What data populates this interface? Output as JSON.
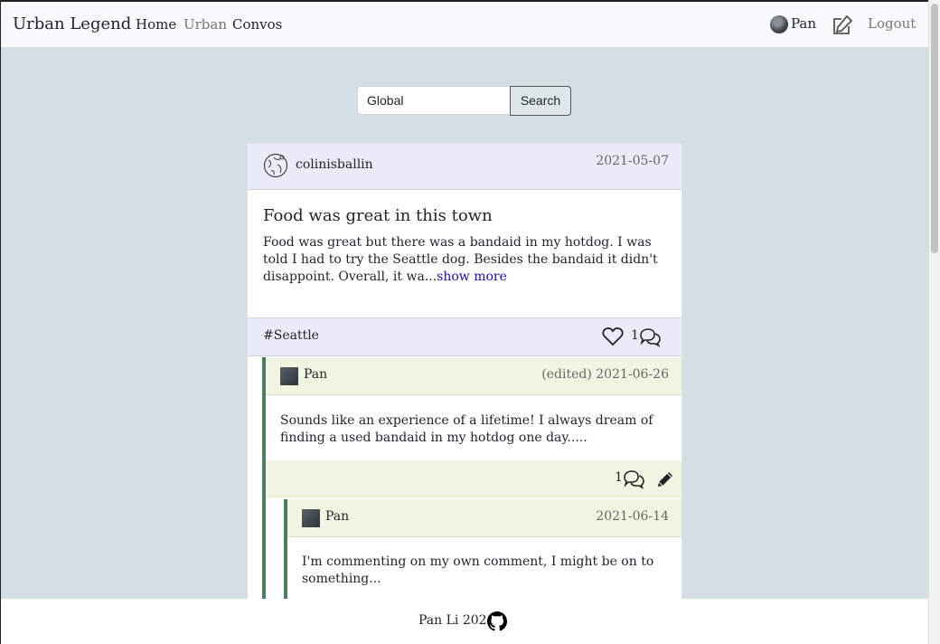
{
  "navbar": {
    "brand": "Urban Legend",
    "links": [
      "Home",
      "Urban",
      "Convos"
    ],
    "user": "Pan",
    "logout": "Logout"
  },
  "search": {
    "value": "Global",
    "button": "Search"
  },
  "post": {
    "author": "colinisballin",
    "date": "2021-05-07",
    "title": "Food was great in this town",
    "body": "Food was great but there was a bandaid in my hotdog. I was told I had to try the Seattle dog. Besides the bandaid it didn't disappoint. Overall, it wa...",
    "show_more": "show more",
    "tag": "#Seattle",
    "comment_count": "1"
  },
  "comments": [
    {
      "author": "Pan",
      "date": "(edited) 2021-06-26",
      "body": "Sounds like an experience of a lifetime! I always dream of finding a used bandaid in my hotdog one day.....",
      "reply_count": "1"
    },
    {
      "author": "Pan",
      "date": "2021-06-14",
      "body": "I'm commenting on my own comment, I might be on to something..."
    }
  ],
  "footer": {
    "text": "Pan Li 2021"
  },
  "colors": {
    "page_bg": "#d3dfe3",
    "card_header": "#e9ecf8",
    "comment_bg": "#f0f5e2",
    "comment_border": "#4a7f5e",
    "link": "#1a0dab"
  },
  "icons": [
    "globe-icon",
    "heart-icon",
    "comment-icon",
    "pencil-icon",
    "edit-icon",
    "github-icon"
  ]
}
